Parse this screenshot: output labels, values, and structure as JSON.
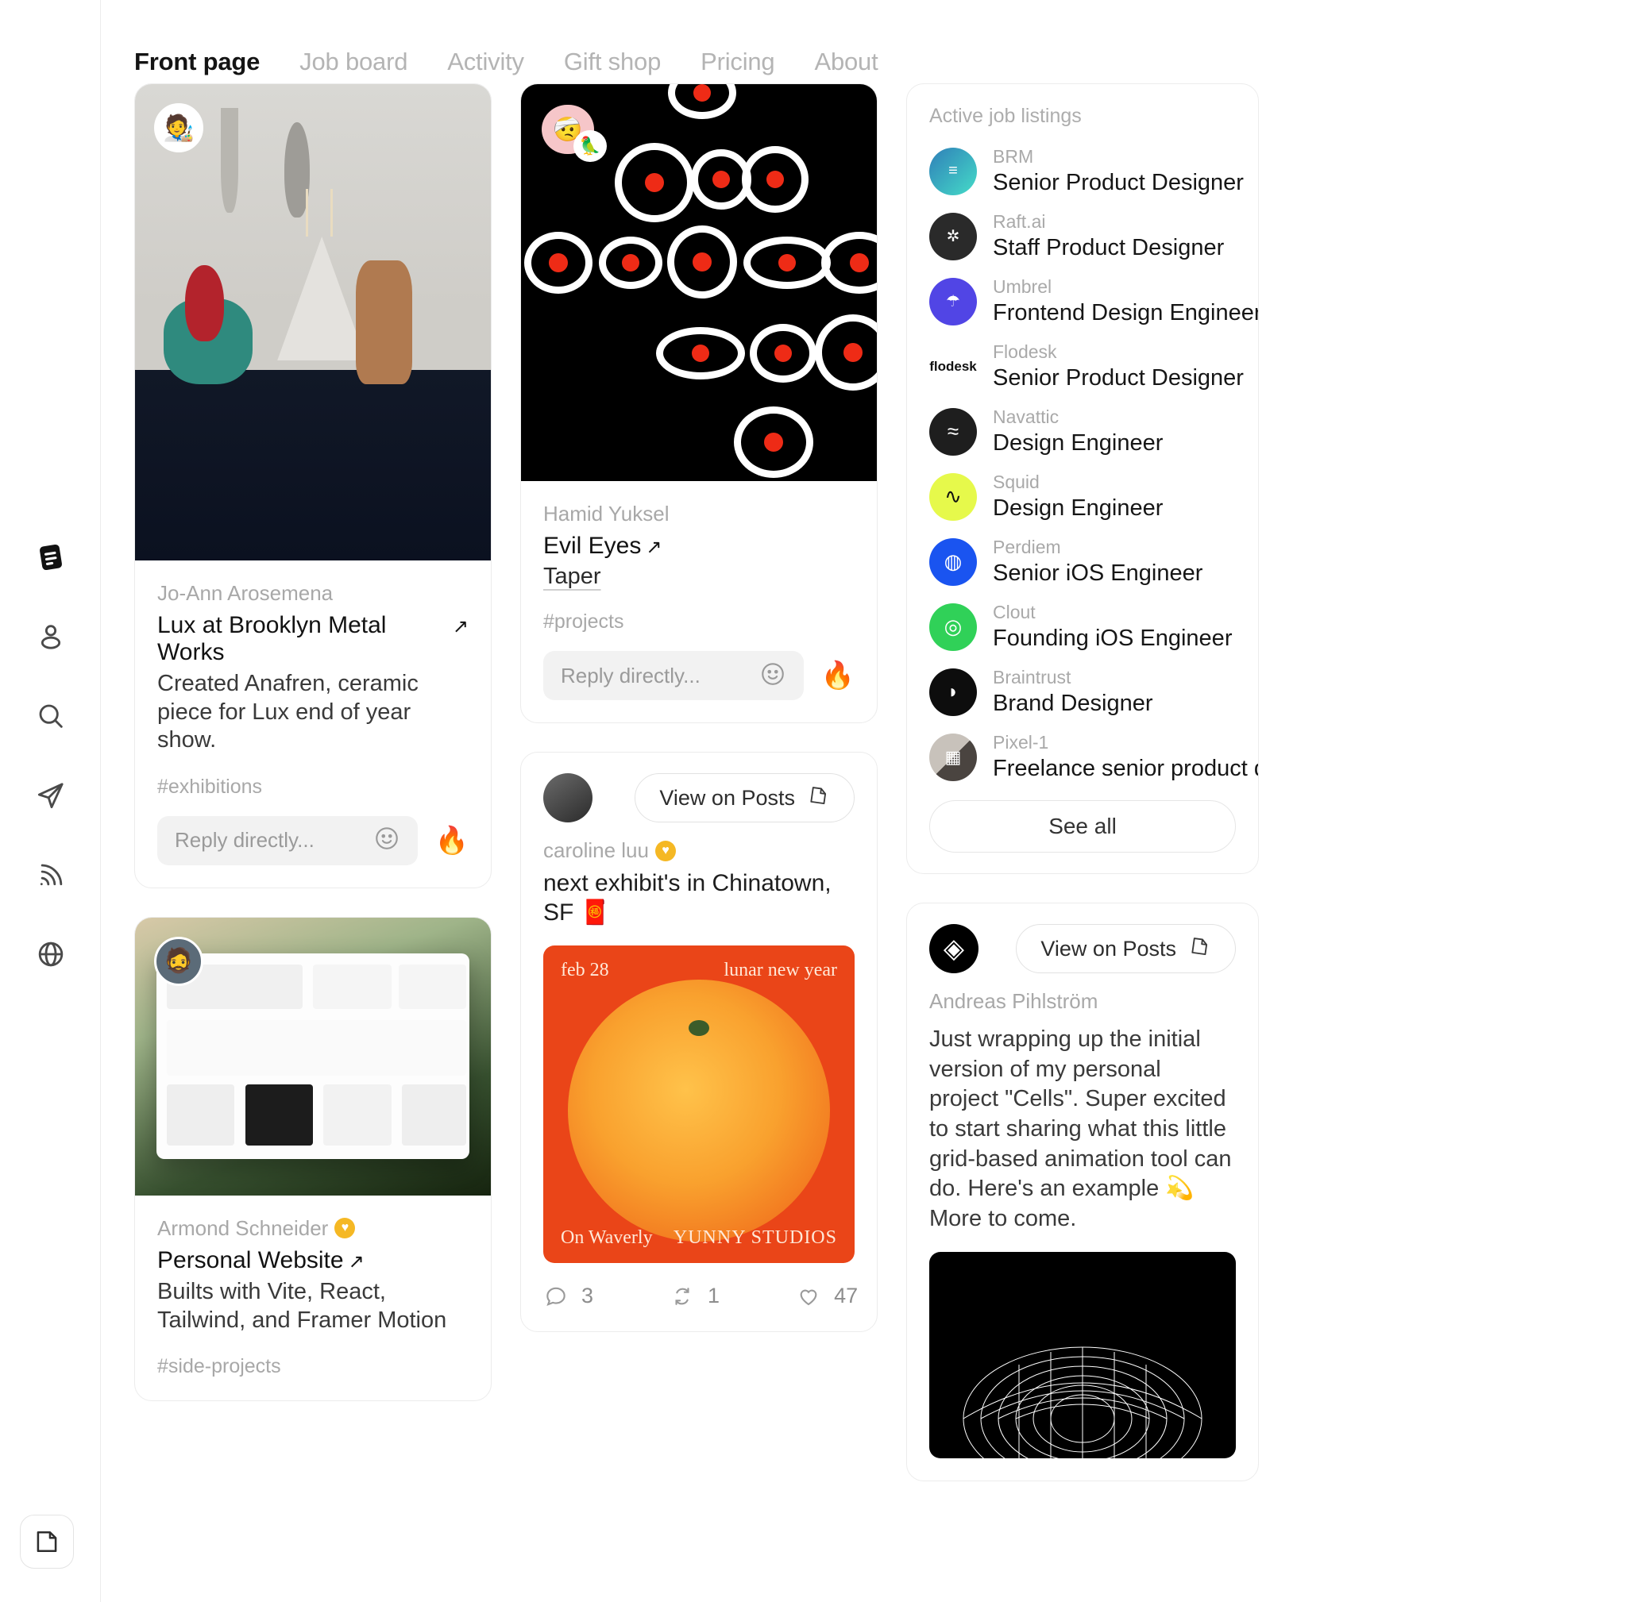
{
  "nav": {
    "items": [
      {
        "label": "Front page",
        "active": true
      },
      {
        "label": "Job board",
        "active": false
      },
      {
        "label": "Activity",
        "active": false
      },
      {
        "label": "Gift shop",
        "active": false
      },
      {
        "label": "Pricing",
        "active": false
      },
      {
        "label": "About",
        "active": false
      }
    ]
  },
  "rail": {
    "icons": [
      "feed-icon",
      "profile-icon",
      "search-icon",
      "send-icon",
      "rss-icon",
      "globe-icon"
    ],
    "bottom_icon": "note-icon"
  },
  "posts": {
    "lux": {
      "author": "Jo-Ann Arosemena",
      "title": "Lux at Brooklyn Metal Works",
      "link_arrow": "↗",
      "body": "Created Anafren, ceramic piece for Lux end of year show.",
      "tag": "#exhibitions",
      "reply_placeholder": "Reply directly...",
      "emoji_icon": "smiley-icon",
      "reaction": "🔥"
    },
    "personal_website": {
      "author": "Armond Schneider",
      "verified": true,
      "title": "Personal Website",
      "link_arrow": "↗",
      "body": "Builts with Vite, React, Tailwind, and Framer Motion",
      "tag": "#side-projects"
    },
    "evil_eyes": {
      "author": "Hamid Yuksel",
      "title": "Evil Eyes",
      "link_arrow": "↗",
      "subtitle": "Taper",
      "tag": "#projects",
      "reply_placeholder": "Reply directly...",
      "reaction": "🔥"
    },
    "caroline": {
      "author": "caroline luu",
      "verified": true,
      "view_button": "View on Posts",
      "text": "next exhibit's in Chinatown, SF 🧧",
      "poster": {
        "top_left": "feb 28",
        "top_right": "lunar new year",
        "bottom_left": "On Waverly",
        "bottom_right": "YUNNY STUDIOS",
        "bg_color": "#ea4518"
      },
      "engagement": {
        "comments": "3",
        "reposts": "1",
        "likes": "47"
      }
    },
    "andreas": {
      "author": "Andreas Pihlström",
      "view_button": "View on Posts",
      "text": "Just wrapping up the initial version of my personal project \"Cells\". Super excited to start sharing what this little grid-based animation tool can do. Here's an example 💫 More to come."
    }
  },
  "jobs": {
    "title": "Active job listings",
    "see_all": "See all",
    "items": [
      {
        "company": "BRM",
        "role": "Senior Product Designer",
        "logo_color": "#2fbfb6",
        "logo_text": "≡"
      },
      {
        "company": "Raft.ai",
        "role": "Staff Product Designer",
        "logo_color": "#2a2a2a",
        "logo_text": "✲"
      },
      {
        "company": "Umbrel",
        "role": "Frontend Design Engineer",
        "logo_color": "#5145e5",
        "logo_text": "☂"
      },
      {
        "company": "Flodesk",
        "role": "Senior Product Designer",
        "logo_color": "#ffffff",
        "logo_text": "flodesk"
      },
      {
        "company": "Navattic",
        "role": "Design Engineer",
        "logo_color": "#1e1e1e",
        "logo_text": "≈"
      },
      {
        "company": "Squid",
        "role": "Design Engineer",
        "logo_color": "#e6f94b",
        "logo_text": "∿"
      },
      {
        "company": "Perdiem",
        "role": "Senior iOS Engineer",
        "logo_color": "#1a54f0",
        "logo_text": "⊕"
      },
      {
        "company": "Clout",
        "role": "Founding iOS Engineer",
        "logo_color": "#30d158",
        "logo_text": "◎"
      },
      {
        "company": "Braintrust",
        "role": "Brand Designer",
        "logo_color": "#0d0d0d",
        "logo_text": "◐"
      },
      {
        "company": "Pixel-1",
        "role": "Freelance senior product desi…",
        "logo_color": "#6e5c52",
        "logo_text": "▦"
      }
    ]
  }
}
